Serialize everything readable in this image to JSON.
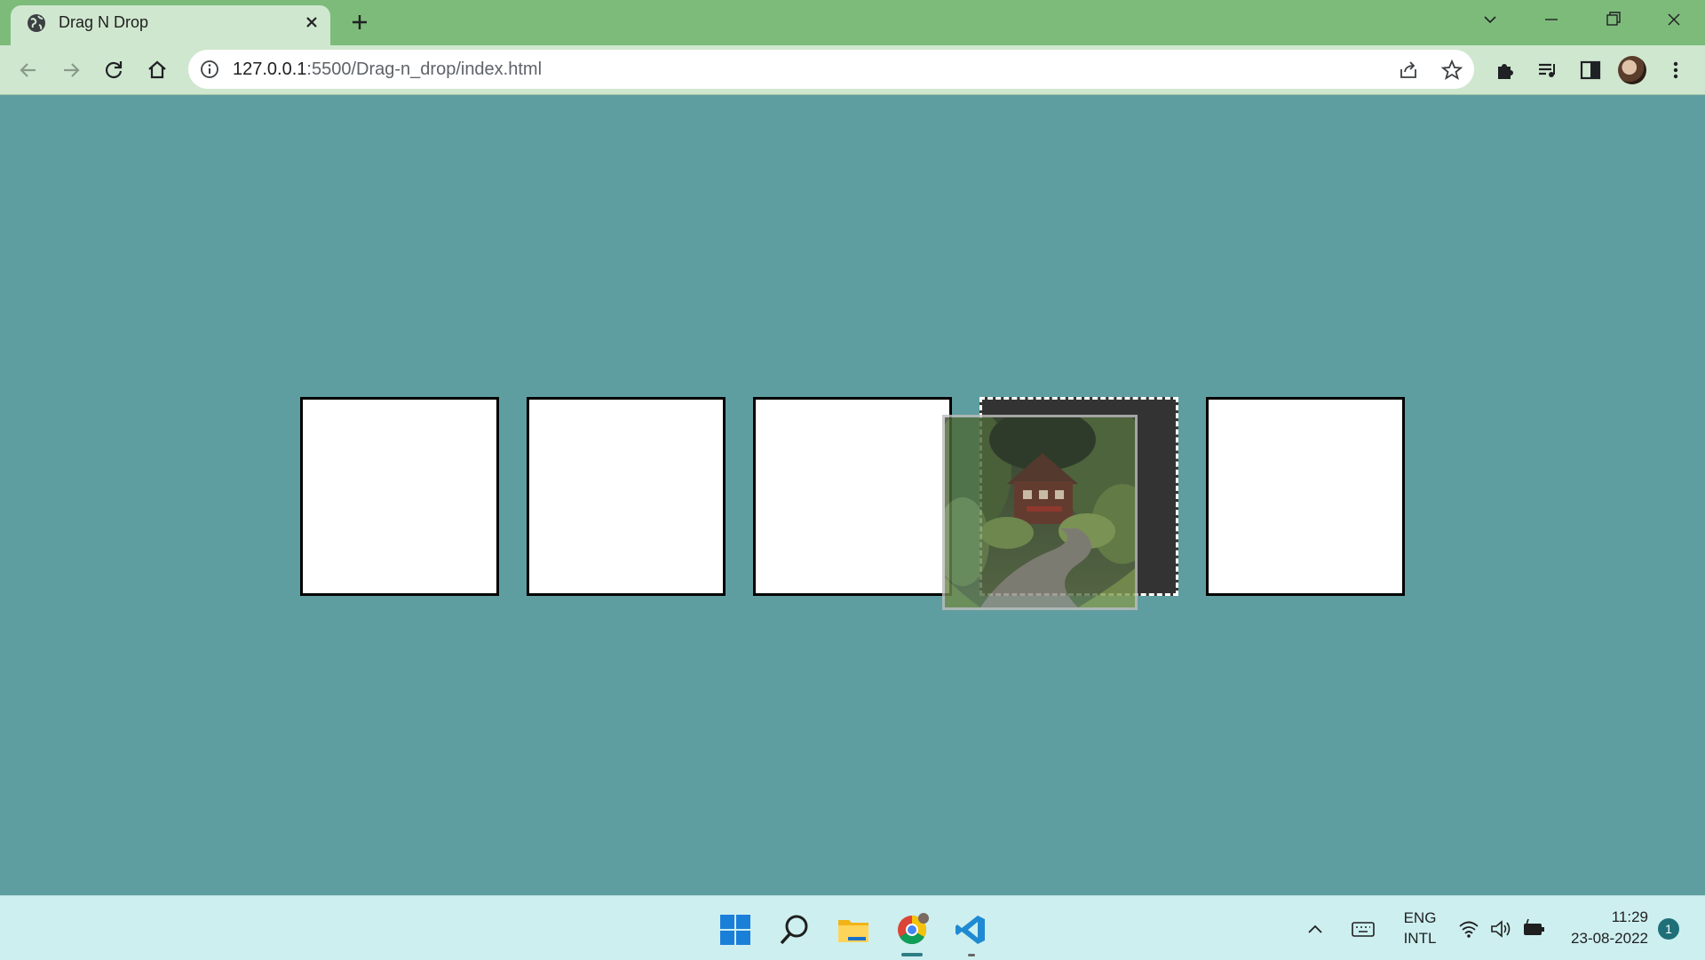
{
  "browser": {
    "tab_title": "Drag N Drop",
    "url_host": "127.0.0.1",
    "url_rest": ":5500/Drag-n_drop/index.html"
  },
  "page": {
    "boxes": [
      {
        "state": "empty"
      },
      {
        "state": "empty"
      },
      {
        "state": "empty"
      },
      {
        "state": "drag-over"
      },
      {
        "state": "empty"
      }
    ],
    "dragged_item": "house-photo"
  },
  "taskbar": {
    "language_line1": "ENG",
    "language_line2": "INTL",
    "time": "11:29",
    "date": "23-08-2022",
    "notification_count": "1"
  },
  "colors": {
    "page_background": "#5f9ea0",
    "box_fill": "#ffffff",
    "hovered_box_fill": "#333333"
  }
}
